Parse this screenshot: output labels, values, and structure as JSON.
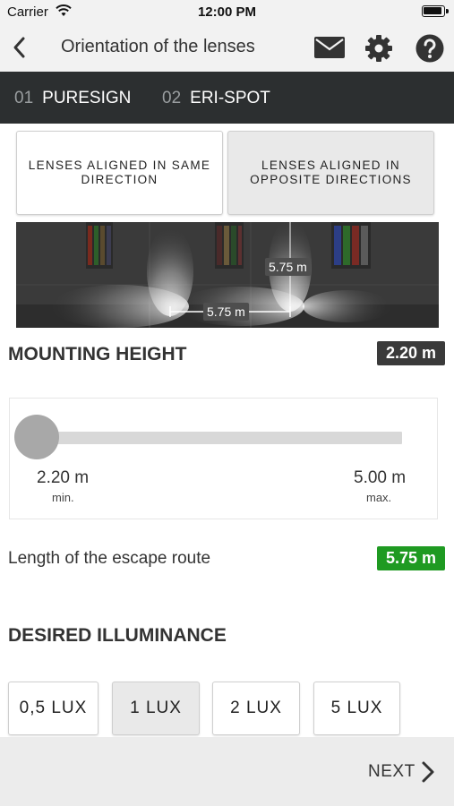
{
  "status_bar": {
    "carrier": "Carrier",
    "time": "12:00 PM"
  },
  "nav": {
    "title": "Orientation of the lenses"
  },
  "steps": [
    {
      "number": "01",
      "label": "PURESIGN"
    },
    {
      "number": "02",
      "label": "ERI-SPOT"
    }
  ],
  "orientation_options": [
    {
      "label": "LENSES ALIGNED IN SAME DIRECTION",
      "selected": true
    },
    {
      "label": "LENSES ALIGNED IN OPPOSITE DIRECTIONS",
      "selected": false
    }
  ],
  "illustration": {
    "spacing_same_label": "5.75 m",
    "spacing_opposite_label": "5.75 m"
  },
  "mounting_height": {
    "title": "MOUNTING HEIGHT",
    "value": "2.20 m",
    "slider": {
      "min_value": "2.20 m",
      "min_caption": "min.",
      "max_value": "5.00 m",
      "max_caption": "max.",
      "level": 0
    }
  },
  "escape_route": {
    "label": "Length of the escape route",
    "value": "5.75 m",
    "color": "#1f9a22"
  },
  "illuminance": {
    "title": "DESIRED ILLUMINANCE",
    "options": [
      "0,5 LUX",
      "1 LUX",
      "2 LUX",
      "5 LUX"
    ],
    "selected": "1 LUX"
  },
  "footer": {
    "next_label": "NEXT"
  }
}
